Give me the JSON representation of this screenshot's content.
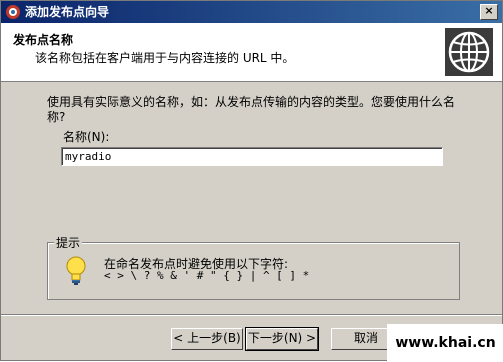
{
  "window": {
    "title": "添加发布点向导",
    "close_label": "×"
  },
  "header": {
    "title": "发布点名称",
    "subtitle": "该名称包括在客户端用于与内容连接的 URL 中。"
  },
  "main": {
    "instruction": "使用具有实际意义的名称，如：从发布点传输的内容的类型。您要使用什么名称?",
    "name_label": "名称(N):",
    "name_value": "myradio"
  },
  "tip": {
    "legend": "提示",
    "line1": "在命名发布点时避免使用以下字符:",
    "line2": "< > \\ ? % & ' # \" { } | ^ [ ] *"
  },
  "buttons": {
    "back": "< 上一步(B)",
    "next": "下一步(N) >",
    "cancel": "取消"
  },
  "watermark": "www.khai.cn",
  "icons": {
    "app": "app-icon",
    "header": "globe-icon",
    "tip": "lightbulb-icon"
  }
}
